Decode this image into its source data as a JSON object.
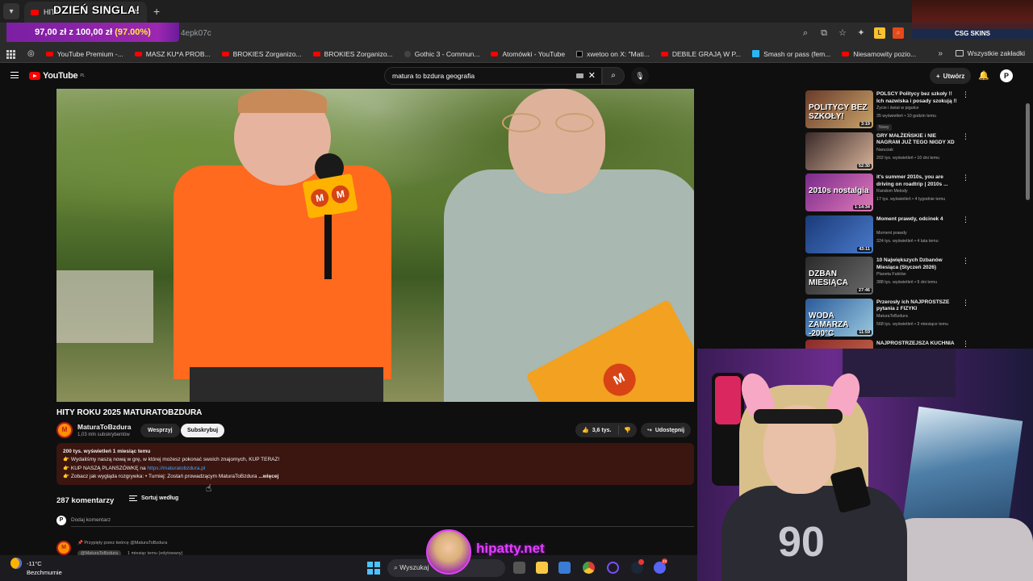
{
  "browser": {
    "tab_title": "HITY",
    "overlay_title": "DZIEŃ SINGLA!",
    "url_fragment": "4epk07c",
    "goal": {
      "text": "97,00 zł z 100,00 zł",
      "percent": "(97.00%)"
    }
  },
  "ad": {
    "label": "CSG SKINS"
  },
  "bookmarks": {
    "items": [
      {
        "label": "YouTube Premium -...",
        "icon": "youtube"
      },
      {
        "label": "MASZ KU*A PROB...",
        "icon": "youtube"
      },
      {
        "label": "BROKIES Zorganizo...",
        "icon": "youtube"
      },
      {
        "label": "BROKIES Zorganizo...",
        "icon": "youtube"
      },
      {
        "label": "Gothic 3 - Commun...",
        "icon": "globe"
      },
      {
        "label": "Atomówki - YouTube",
        "icon": "youtube"
      },
      {
        "label": "xwetoo on X: \"Mati...",
        "icon": "x"
      },
      {
        "label": "DEBILE GRAJĄ W P...",
        "icon": "youtube"
      },
      {
        "label": "Smash or pass (fem...",
        "icon": "tier"
      },
      {
        "label": "Niesamowity pozio...",
        "icon": "youtube"
      }
    ],
    "all_label": "Wszystkie zakładki"
  },
  "youtube": {
    "logo": "YouTube",
    "logo_region": "PL",
    "search_query": "matura to bzdura geografia",
    "create_label": "Utwórz",
    "user_initial": "P"
  },
  "video": {
    "title": "HITY ROKU 2025 MATURATOBZDURA",
    "channel": "MaturaToBzdura",
    "subscribers": "1,03 mln subskrybentów",
    "support_label": "Wesprzyj",
    "subscribe_label": "Subskrybuj",
    "likes": "3,6 tys.",
    "share_label": "Udostępnij",
    "mic_letter": "M"
  },
  "description": {
    "stats": "200 tys. wyświetleń  1 miesiąc temu",
    "line1": "👉 Wydaliśmy naszą nową w grę, w której możesz pokonać swoich znajomych, KUP TERAZ!",
    "line2_prefix": "👉 KUP NASZĄ PLANSZÓWKĘ na ",
    "line2_link": "https://maturatobzdura.pl",
    "line3_prefix": "👉 Zobacz jak wygląda rozgrywka:  ",
    "line3_text": "• Turniej: Zostań prowadzącym MaturaToBzdura",
    "more": "...więcej"
  },
  "comments": {
    "count": "287 komentarzy",
    "sort_label": "Sortuj według",
    "add_placeholder": "Dodaj komentarz",
    "pinned": "Przypięty przez twórcę @MaturaToBzdura",
    "author": "@MaturaToBzdura",
    "time": "1 miesiąc temu (edytowany)"
  },
  "recommendations": [
    {
      "title": "POLSCY Politycy bez szkoły !! Ich nazwiska i posady szokują !!",
      "channel": "Życie i świat w pigułce",
      "meta": "35 wyświetleń • 10 godzin temu",
      "badge": "Nowy",
      "duration": "3:19",
      "thumb_text": "POLITYCY BEZ SZKOŁY!",
      "colors": [
        "#6a3b2a",
        "#c9a36a"
      ]
    },
    {
      "title": "GRY MAŁŻEŃSKIE i NIE NAGRAM JUŻ TEGO NIGDY XD",
      "channel": "Naruciak",
      "meta": "202 tys. wyświetleń • 10 dni temu",
      "badge": "",
      "duration": "52:30",
      "thumb_text": "",
      "colors": [
        "#3b2a2a",
        "#d9b49a"
      ]
    },
    {
      "title": "it's summer 2010s, you are driving on roadtrip | 2010s ...",
      "channel": "Random Melody",
      "meta": "17 tys. wyświetleń • 4 tygodnie temu",
      "badge": "",
      "duration": "1:14:34",
      "thumb_text": "2010s nostalgia",
      "colors": [
        "#7a2a8c",
        "#e07ab8"
      ]
    },
    {
      "title": "Moment prawdy, odcinek 4",
      "channel": "Moment prawdy",
      "meta": "324 tys. wyświetleń • 4 lata temu",
      "badge": "",
      "duration": "43:11",
      "thumb_text": "",
      "colors": [
        "#1a3a7a",
        "#4a7ac9"
      ]
    },
    {
      "title": "10 Największych Dzbanów Miesiąca (Styczeń 2026)",
      "channel": "Planeta Faktów",
      "meta": "388 tys. wyświetleń • 9 dni temu",
      "badge": "",
      "duration": "27:46",
      "thumb_text": "DZBAN MIESIĄCA",
      "colors": [
        "#2a2a2a",
        "#6a6a6a"
      ]
    },
    {
      "title": "Przerosły ich NAJPROSTSZE pytania z FIZYKI",
      "channel": "MaturaToBzdura",
      "meta": "568 tys. wyświetleń • 3 miesiące temu",
      "badge": "",
      "duration": "11:59",
      "thumb_text": "WODA ZAMARZA -200°C",
      "colors": [
        "#2a5a9a",
        "#9ac9e0"
      ]
    },
    {
      "title": "NAJPROSTRZEJSZA KUCHNIA",
      "channel": "",
      "meta": "",
      "badge": "",
      "duration": "",
      "thumb_text": "",
      "colors": [
        "#8a2a2a",
        "#c96a4a"
      ]
    }
  ],
  "webcam": {
    "jersey_number": "90"
  },
  "watermark": {
    "text": "hipatty.net"
  },
  "taskbar": {
    "temperature": "-11°C",
    "weather": "Bezchmurnie",
    "search_placeholder": "Wyszukaj",
    "notification_count": "23"
  },
  "colors": {
    "yt_red": "#ff0000",
    "link_blue": "#3ea6ff",
    "goal_purple": "#9c27b0",
    "description_bg": "#3b1510",
    "watermark_pink": "#e040fb"
  }
}
